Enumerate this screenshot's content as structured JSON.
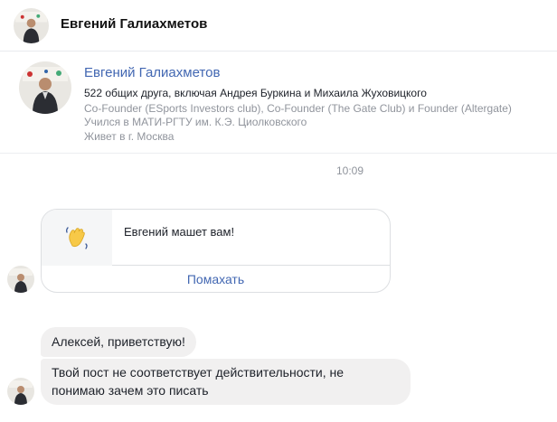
{
  "header": {
    "title": "Евгений Галиахметов"
  },
  "profile": {
    "name": "Евгений Галиахметов",
    "mutual_friends": "522 общих друга, включая Андрея Буркина и Михаила Жуховицкого",
    "work": "Co-Founder (ESports Investors club), Co-Founder (The Gate Club) и Founder (Altergate)",
    "education": "Учился в МАТИ-РГТУ им. К.Э. Циолковского",
    "location": "Живет в г. Москва"
  },
  "chat": {
    "timestamp": "10:09",
    "wave": {
      "text": "Евгений машет вам!",
      "button_label": "Помахать",
      "icon": "waving-hand-icon"
    },
    "messages": [
      {
        "text": "Алексей, приветствую!"
      },
      {
        "text": "Твой пост не соответствует действительности, не понимаю зачем это писать"
      }
    ]
  },
  "colors": {
    "link": "#4267b2",
    "bubble": "#f1f0f0",
    "muted": "#90949c",
    "wave_yellow": "#f7c948"
  }
}
